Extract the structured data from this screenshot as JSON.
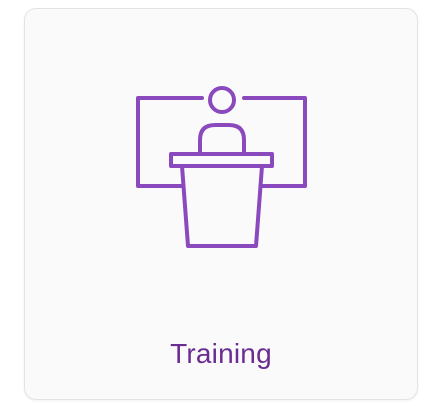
{
  "card": {
    "label": "Training",
    "icon": "presenter-podium-icon"
  },
  "colors": {
    "accent": "#8a49bd",
    "label": "#6a2c91",
    "card_background": "#fafafa",
    "card_border": "#e3e3e6"
  }
}
